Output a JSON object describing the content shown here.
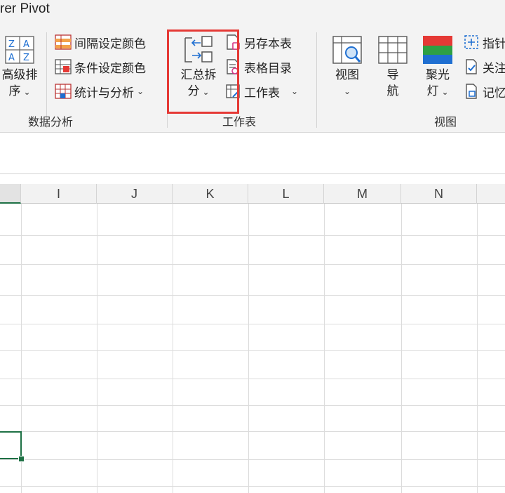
{
  "ribbon": {
    "tab_title": "rer Pivot",
    "groups": {
      "data_analysis": {
        "label": "数据分析",
        "advanced_sort": {
          "line1": "高级排",
          "line2": "序"
        },
        "interval_color": "间隔设定颜色",
        "conditional_color": "条件设定颜色",
        "stats_analysis": "统计与分析"
      },
      "worksheet": {
        "label": "工作表",
        "summary_split": {
          "line1": "汇总拆",
          "line2": "分"
        },
        "save_as_sheet": "另存本表",
        "sheet_directory": "表格目录",
        "worksheet_menu": "工作表"
      },
      "view": {
        "label": "视图",
        "view_btn": {
          "line1": "视图"
        },
        "navigate_btn": {
          "line1": "导",
          "line2": "航"
        },
        "spotlight_btn": {
          "line1": "聚光",
          "line2": "灯"
        },
        "pointer": "指针",
        "focus": "关注",
        "memory": "记忆"
      }
    }
  },
  "colors": {
    "highlight": "#e53935",
    "excel_green": "#1e7145",
    "spotlight_red": "#e53935",
    "spotlight_green": "#2ea043",
    "spotlight_blue": "#1f6fd1"
  },
  "sheet": {
    "columns": [
      "I",
      "J",
      "K",
      "L",
      "M",
      "N"
    ]
  }
}
